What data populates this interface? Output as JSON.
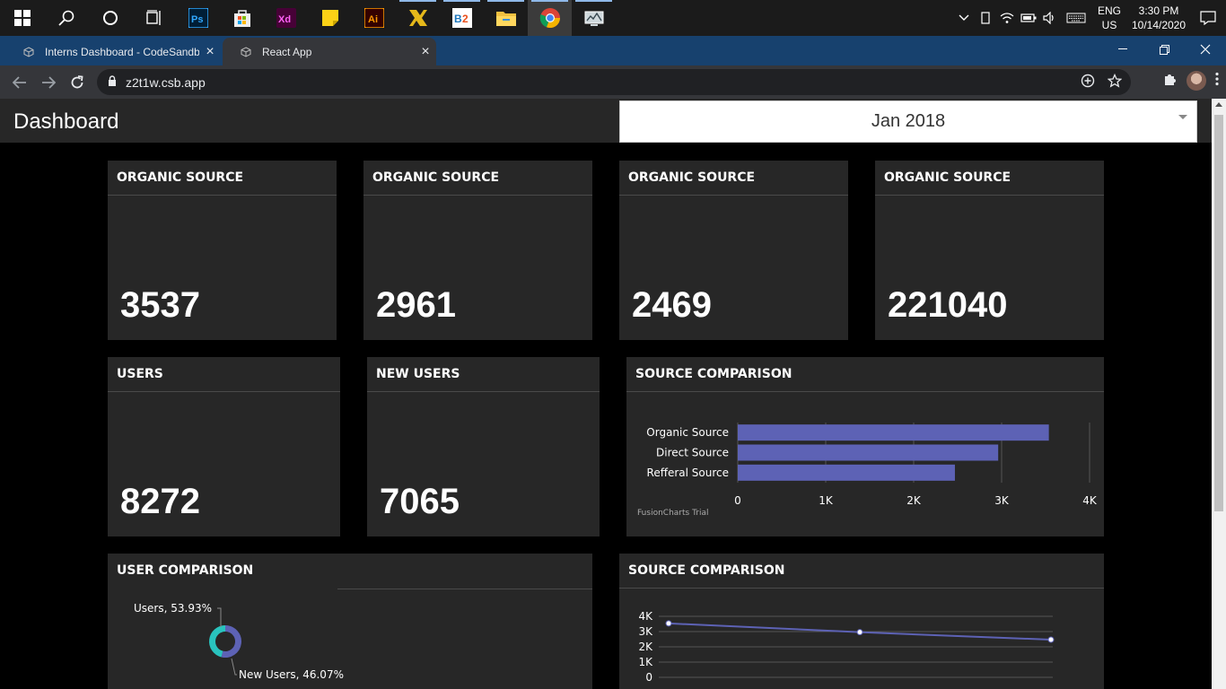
{
  "taskbar": {
    "apps": [
      "windows-start",
      "search",
      "cortana",
      "task-view",
      "photoshop",
      "store",
      "xd",
      "sticky-notes",
      "illustrator",
      "app-yellow",
      "app-b2",
      "file-explorer",
      "chrome",
      "app-monitor"
    ],
    "lang_top": "ENG",
    "lang_bottom": "US",
    "time": "3:30 PM",
    "date": "10/14/2020"
  },
  "browser": {
    "tabs": [
      {
        "label": "Interns Dashboard - CodeSandbox"
      },
      {
        "label": "React App"
      }
    ],
    "url": "z2t1w.csb.app"
  },
  "dashboard": {
    "title": "Dashboard",
    "month": "Jan 2018",
    "kpis": [
      {
        "label": "ORGANIC SOURCE",
        "value": "3537"
      },
      {
        "label": "ORGANIC SOURCE",
        "value": "2961"
      },
      {
        "label": "ORGANIC SOURCE",
        "value": "2469"
      },
      {
        "label": "ORGANIC SOURCE",
        "value": "221040"
      },
      {
        "label": "USERS",
        "value": "8272"
      },
      {
        "label": "NEW USERS",
        "value": "7065"
      }
    ],
    "source_bar_title": "SOURCE COMPARISON",
    "user_comparison_title": "USER COMPARISON",
    "source_line_title": "SOURCE COMPARISON",
    "trial_text": "FusionCharts Trial"
  },
  "colors": {
    "bar": "#5d62b5",
    "teal": "#29c3be",
    "card": "#272727"
  },
  "chart_data": [
    {
      "type": "bar",
      "orientation": "horizontal",
      "title": "",
      "categories": [
        "Organic Source",
        "Direct Source",
        "Refferal Source"
      ],
      "values": [
        3537,
        2961,
        2469
      ],
      "xlim": [
        0,
        4000
      ],
      "ticks": [
        "0",
        "1K",
        "2K",
        "3K",
        "4K"
      ],
      "grid": true
    },
    {
      "type": "pie",
      "title": "",
      "labels": [
        "Users, 53.93%",
        "New Users, 46.07%"
      ],
      "values": [
        53.93,
        46.07
      ],
      "legend": [
        "Users",
        "New Users"
      ],
      "legend_position": "bottom"
    },
    {
      "type": "line",
      "title": "",
      "values": [
        3537,
        2961,
        2469
      ],
      "ylim": [
        0,
        4000
      ],
      "yticks": [
        "4K",
        "3K",
        "2K",
        "1K",
        "0"
      ],
      "grid": true
    }
  ]
}
